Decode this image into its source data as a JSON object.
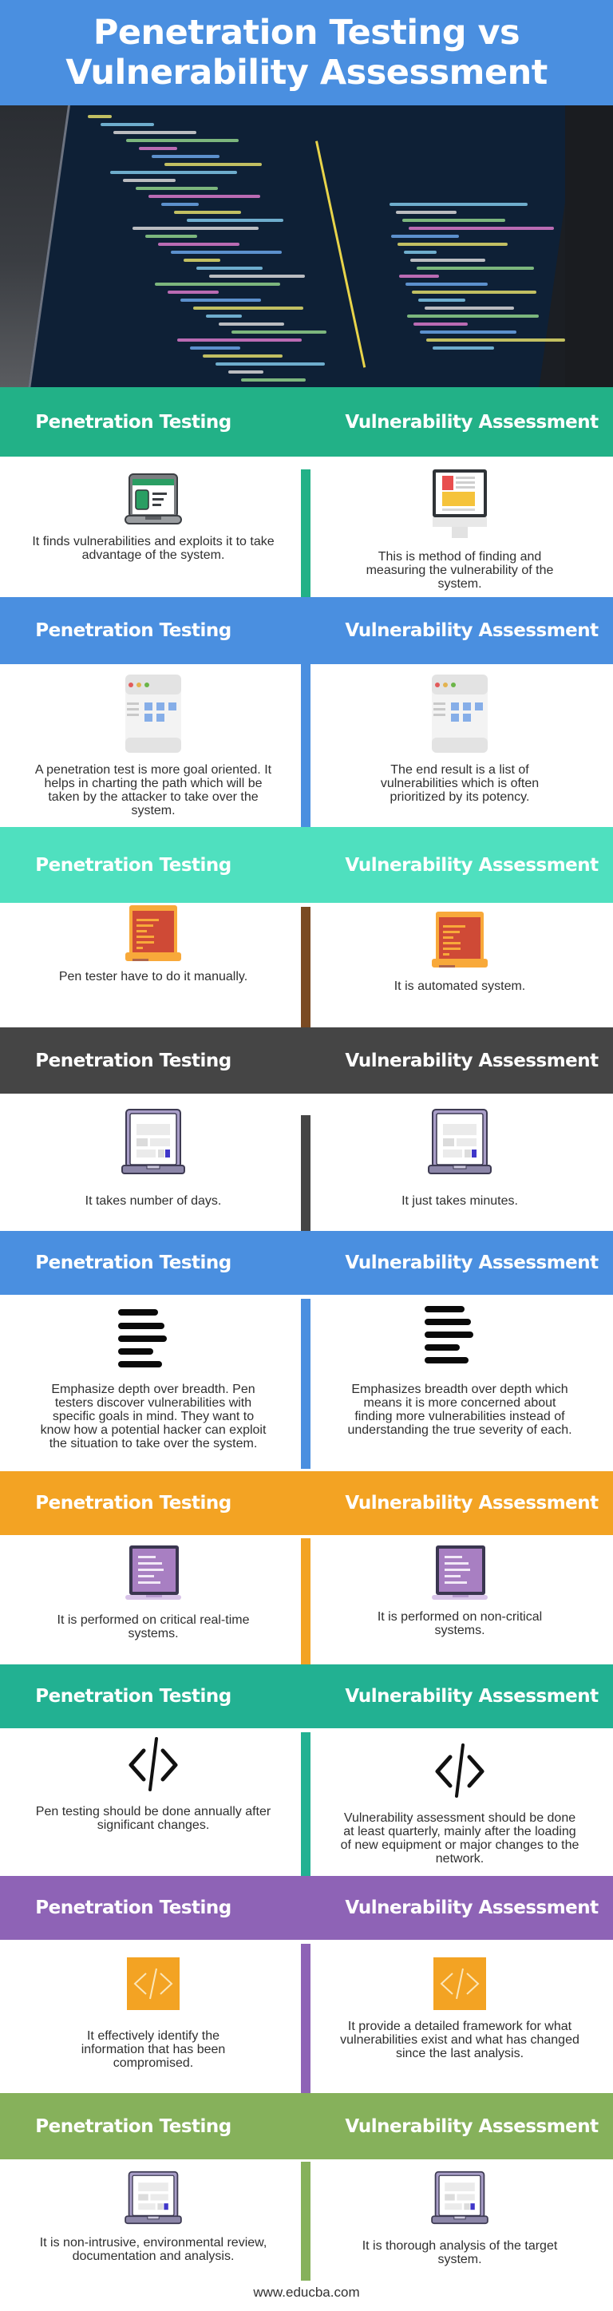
{
  "title": {
    "line1": "Penetration Testing vs",
    "line2": "Vulnerability Assessment",
    "color": "#4a8fe0"
  },
  "hero": {
    "image": "code-editor-on-laptop-photo"
  },
  "columns": {
    "left": "Penetration Testing",
    "right": "Vulnerability Assessment"
  },
  "sections": [
    {
      "color": "#22b187",
      "left_icon": "laptop-green-icon",
      "right_icon": "desktop-monitor-icon",
      "left": "It finds vulnerabilities and exploits it to take advantage of the system.",
      "right": "This is method of finding and measuring the vulnerability of the system."
    },
    {
      "color": "#4a8fe0",
      "left_icon": "browser-window-icon",
      "right_icon": "browser-window-icon",
      "left": "A penetration test is more goal oriented. It helps in charting the path which will be taken by the attacker to take over the system.",
      "right": "The end result is a list of vulnerabilities which is often prioritized by its potency."
    },
    {
      "color": "#4fe0bf",
      "divider_color": "#7a4a22",
      "left_icon": "laptop-orange-icon",
      "right_icon": "laptop-orange-icon",
      "left": "Pen tester have to do it manually.",
      "right": "It is automated system."
    },
    {
      "color": "#454545",
      "left_icon": "laptop-purple-outline-icon",
      "right_icon": "laptop-purple-outline-icon",
      "left": "It takes number of days.",
      "right": "It just takes minutes."
    },
    {
      "color": "#4a8fe0",
      "left_icon": "text-lines-icon",
      "right_icon": "text-lines-icon",
      "left": "Emphasize depth over breadth. Pen testers discover vulnerabilities with specific goals in mind. They want to know how a potential hacker can exploit the situation to take over the system.",
      "right": "Emphasizes breadth over depth which means it is more concerned about finding more vulnerabilities instead of understanding the true severity of each."
    },
    {
      "color": "#f3a323",
      "left_icon": "laptop-violet-icon",
      "right_icon": "laptop-violet-icon",
      "left": "It is performed on critical real-time systems.",
      "right": "It is performed on non-critical systems."
    },
    {
      "color": "#22b192",
      "left_icon": "code-tag-icon",
      "right_icon": "code-tag-icon",
      "left": "Pen testing should be done annually after significant changes.",
      "right": "Vulnerability assessment should be done at least quarterly, mainly after the loading of new equipment or major changes to the network."
    },
    {
      "color": "#8e63b6",
      "left_icon": "code-tag-orange-box-icon",
      "right_icon": "code-tag-orange-box-icon",
      "left": "It effectively identify the information that has been compromised.",
      "right": "It provide a detailed framework for what vulnerabilities exist and what has changed since the last analysis."
    },
    {
      "color": "#86b15b",
      "left_icon": "laptop-purple-outline-icon",
      "right_icon": "laptop-purple-outline-icon",
      "left": "It is non-intrusive, environmental review, documentation and analysis.",
      "right": "It is thorough analysis of the target system."
    }
  ],
  "footer": "www.educba.com"
}
